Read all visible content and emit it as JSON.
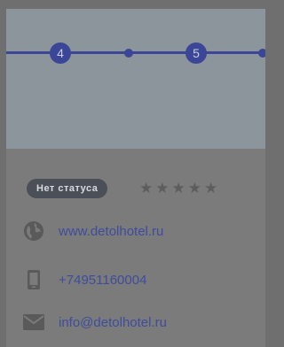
{
  "steps": [
    {
      "label": "4"
    },
    {
      "label": "5"
    }
  ],
  "status": {
    "label": "Нет статуса"
  },
  "rating": {
    "stars_total": 5,
    "stars_filled": 0
  },
  "contacts": {
    "website": "www.detolhotel.ru",
    "phone": "+74951160004",
    "email": "info@detolhotel.ru"
  },
  "colors": {
    "accent": "#3b4796",
    "link": "#3e4c9c",
    "badge": "#4b4f57"
  },
  "icons": {
    "website": "globe-icon",
    "phone": "phone-icon",
    "email": "envelope-icon",
    "star": "star-icon"
  }
}
